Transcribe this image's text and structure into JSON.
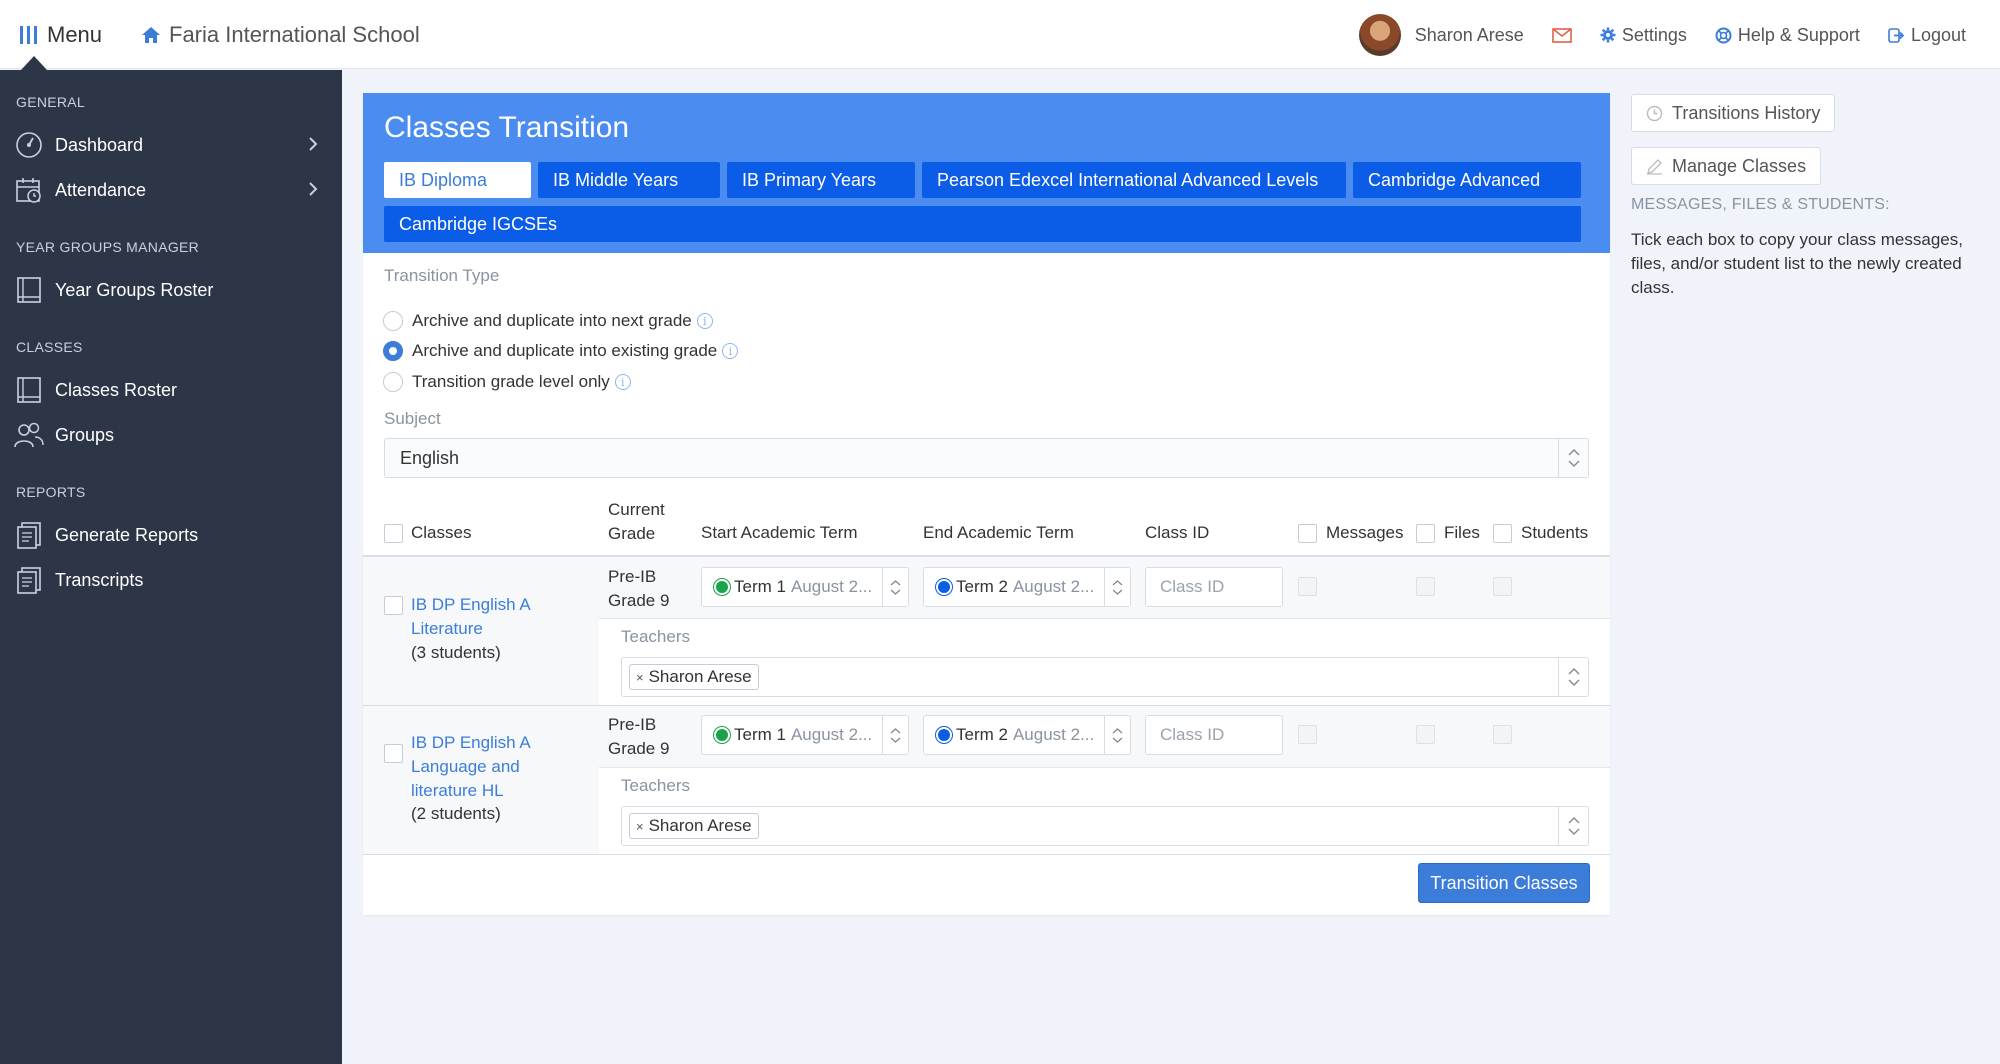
{
  "topbar": {
    "menu_label": "Menu",
    "school_name": "Faria International School",
    "user_name": "Sharon Arese",
    "settings_label": "Settings",
    "help_label": "Help & Support",
    "logout_label": "Logout"
  },
  "sidebar": {
    "sections": [
      {
        "label": "GENERAL",
        "items": [
          {
            "label": "Dashboard",
            "icon": "dashboard-icon",
            "has_chevron": true
          },
          {
            "label": "Attendance",
            "icon": "attendance-icon",
            "has_chevron": true
          }
        ]
      },
      {
        "label": "YEAR GROUPS MANAGER",
        "items": [
          {
            "label": "Year Groups Roster",
            "icon": "book-icon"
          }
        ]
      },
      {
        "label": "CLASSES",
        "items": [
          {
            "label": "Classes Roster",
            "icon": "book-icon"
          },
          {
            "label": "Groups",
            "icon": "users-icon"
          }
        ]
      },
      {
        "label": "REPORTS",
        "items": [
          {
            "label": "Generate Reports",
            "icon": "report-icon"
          },
          {
            "label": "Transcripts",
            "icon": "transcript-icon"
          }
        ]
      }
    ]
  },
  "panel": {
    "title": "Classes Transition",
    "tabs": [
      {
        "label": "IB Diploma",
        "active": true
      },
      {
        "label": "IB Middle Years",
        "active": false
      },
      {
        "label": "IB Primary Years",
        "active": false
      },
      {
        "label": "Pearson Edexcel International Advanced Levels",
        "active": false
      },
      {
        "label": "Cambridge Advanced",
        "active": false
      },
      {
        "label": "Cambridge IGCSEs",
        "active": false
      }
    ],
    "transition_type_label": "Transition Type",
    "transition_options": [
      {
        "label": "Archive and duplicate into next grade",
        "selected": false
      },
      {
        "label": "Archive and duplicate into existing grade",
        "selected": true
      },
      {
        "label": "Transition grade level only",
        "selected": false
      }
    ],
    "subject_label": "Subject",
    "subject_value": "English",
    "columns": {
      "classes": "Classes",
      "current_grade_line1": "Current",
      "current_grade_line2": "Grade",
      "start_term": "Start Academic Term",
      "end_term": "End Academic Term",
      "class_id": "Class ID",
      "messages": "Messages",
      "files": "Files",
      "students": "Students"
    },
    "rows": [
      {
        "class_line1": "IB DP English A",
        "class_line2": "Literature",
        "class_line3": "",
        "student_count": "(3 students)",
        "grade_line1": "Pre-IB",
        "grade_line2": "Grade 9",
        "start_term": "Term 1",
        "start_term_sub": "August 2...",
        "end_term": "Term 2",
        "end_term_sub": "August 2...",
        "class_id_placeholder": "Class ID",
        "teachers_label": "Teachers",
        "teacher_tag": "Sharon Arese"
      },
      {
        "class_line1": "IB DP English A",
        "class_line2": "Language and",
        "class_line3": "literature HL",
        "student_count": "(2 students)",
        "grade_line1": "Pre-IB",
        "grade_line2": "Grade 9",
        "start_term": "Term 1",
        "start_term_sub": "August 2...",
        "end_term": "Term 2",
        "end_term_sub": "August 2...",
        "class_id_placeholder": "Class ID",
        "teachers_label": "Teachers",
        "teacher_tag": "Sharon Arese"
      }
    ],
    "submit_label": "Transition Classes"
  },
  "aside": {
    "history_label": "Transitions History",
    "manage_label": "Manage Classes",
    "heading": "MESSAGES, FILES & STUDENTS:",
    "help_text": "Tick each box to copy your class messages, files, and/or student list to the newly created class."
  },
  "colors": {
    "accent": "#3b7dd8",
    "header_blue": "#4a8cf0",
    "tab_blue": "#0b5ce6",
    "sidebar_bg": "#2c3646",
    "term_start_dot": "#1aa34a",
    "term_end_dot": "#0b5ce6"
  }
}
